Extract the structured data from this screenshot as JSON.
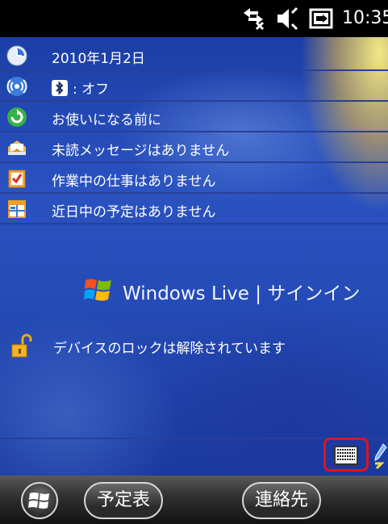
{
  "statusbar": {
    "time": "10:35",
    "icons": [
      "connectivity-icon",
      "volume-icon",
      "battery-charging-icon"
    ]
  },
  "today": {
    "items": [
      {
        "icon": "clock-icon",
        "label": "2010年1月2日"
      },
      {
        "icon": "wireless-icon",
        "label": ": オフ",
        "badge": "bluetooth-icon"
      },
      {
        "icon": "getting-started-icon",
        "label": "お使いになる前に"
      },
      {
        "icon": "messaging-icon",
        "label": "未読メッセージはありません"
      },
      {
        "icon": "tasks-icon",
        "label": "作業中の仕事はありません"
      },
      {
        "icon": "calendar-icon",
        "label": "近日中の予定はありません"
      }
    ],
    "windows_live": "Windows Live | サインイン",
    "lock_status": "デバイスのロックは解除されています"
  },
  "input": {
    "keyboard_icon": "keyboard-icon",
    "pen_icon": "pen-icon"
  },
  "softkeys": {
    "left": "予定表",
    "right": "連絡先"
  },
  "colors": {
    "highlight": "#e0151a",
    "wallpaper": "#2a52c0"
  }
}
